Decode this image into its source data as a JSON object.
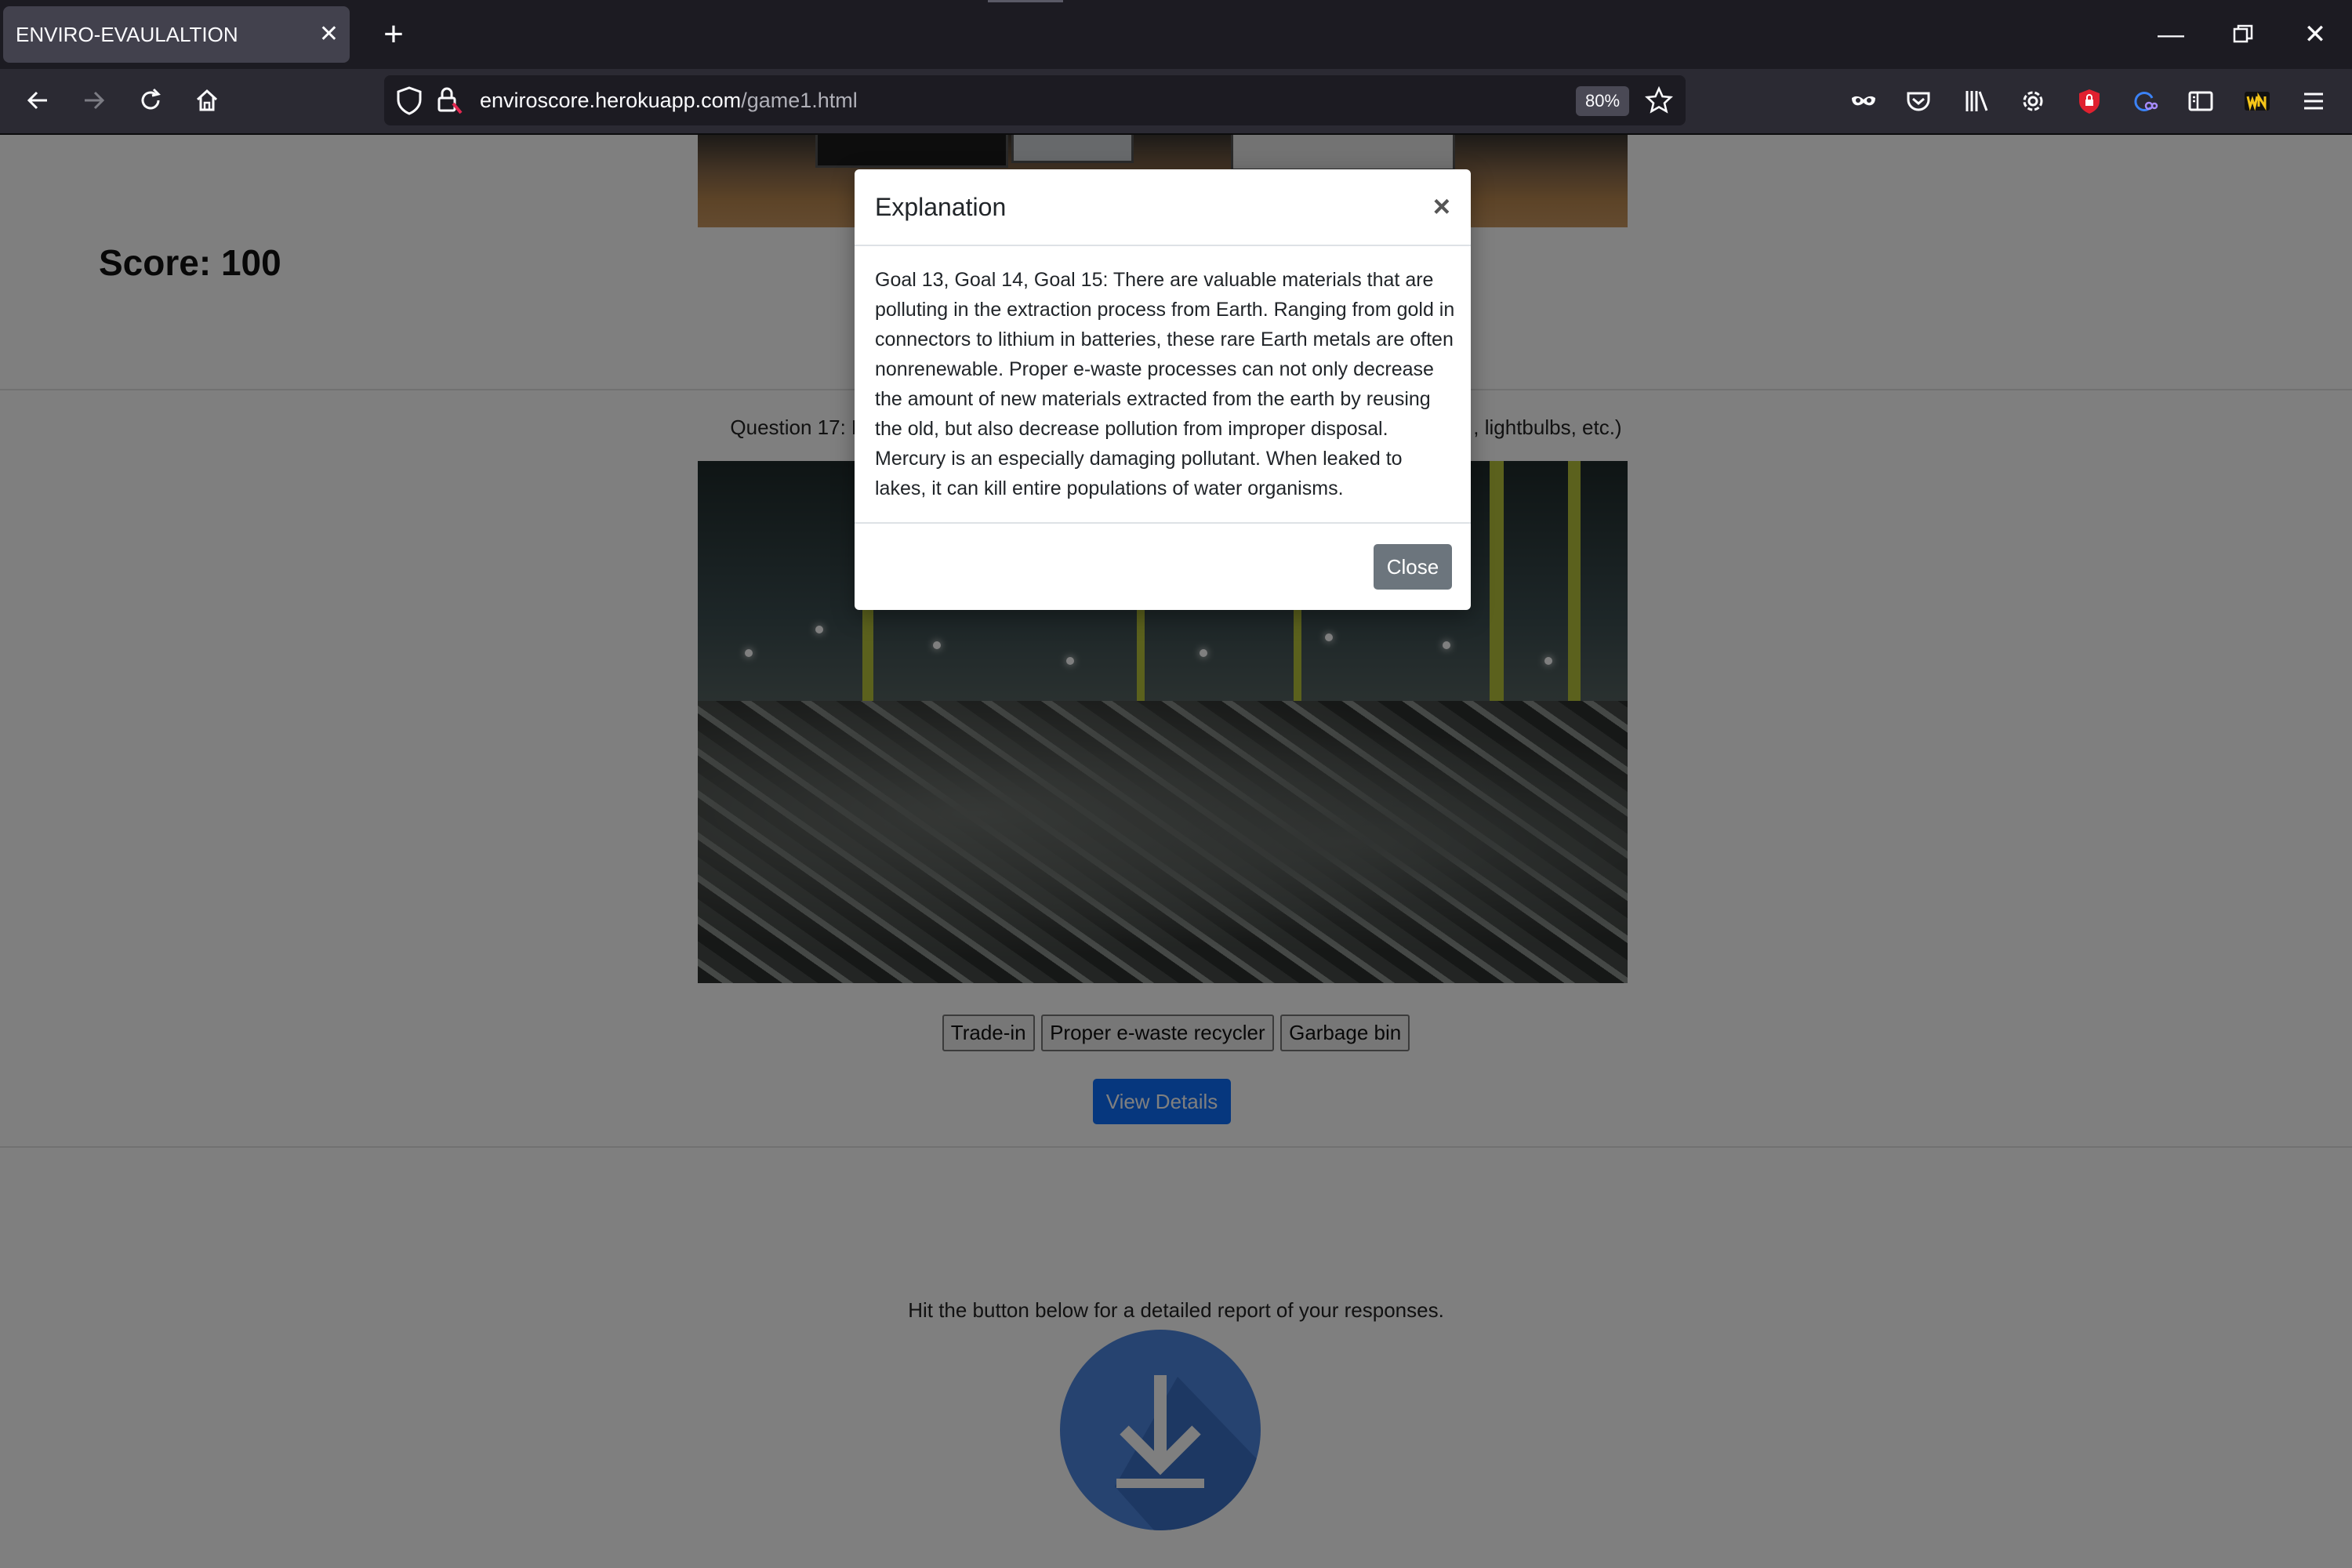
{
  "browser": {
    "tab_title": "ENVIRO-EVAULALTION",
    "tab_close_icon": "close-icon",
    "new_tab_icon": "plus-icon",
    "url_domain": "enviroscore.herokuapp.com",
    "url_path": "/game1.html",
    "zoom": "80%",
    "toolbar_icons": [
      "mask-icon",
      "pocket-icon",
      "library-icon",
      "gear-icon",
      "shield-extension-icon",
      "extension-icon",
      "reader-view-icon",
      "wn-extension-icon",
      "menu-icon"
    ]
  },
  "page": {
    "score_label": "Score: 100",
    "question_left": "Question 17: Ho",
    "question_right": ", lightbulbs, etc.)",
    "answers": [
      "Trade-in",
      "Proper e-waste recycler",
      "Garbage bin"
    ],
    "view_details": "View Details",
    "report_text": "Hit the button below for a detailed report of your responses."
  },
  "modal": {
    "title": "Explanation",
    "body": "Goal 13, Goal 14, Goal 15: There are valuable materials that are polluting in the extraction process from Earth. Ranging from gold in connectors to lithium in batteries, these rare Earth metals are often nonrenewable. Proper e-waste processes can not only decrease the amount of new materials extracted from the earth by reusing the old, but also decrease pollution from improper disposal. Mercury is an especially damaging pollutant. When leaked to lakes, it can kill entire populations of water organisms.",
    "close_label": "Close",
    "x_label": "×"
  },
  "colors": {
    "primary_button": "#0d6efd",
    "secondary_button": "#6c757d",
    "download_circle": "#4d86e0"
  }
}
